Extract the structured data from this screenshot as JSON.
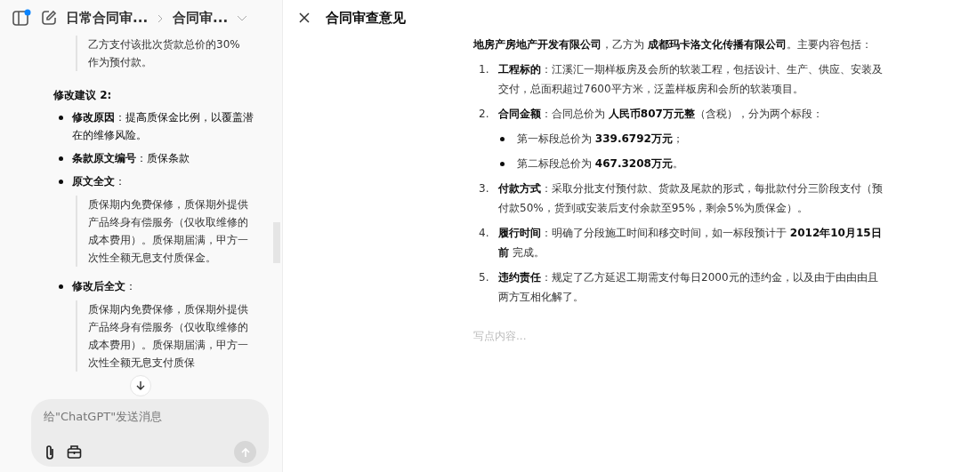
{
  "sidebar": {
    "breadcrumb": [
      "日常合同审...",
      "合同审..."
    ],
    "quote_tail": [
      "乙方支付该批次货款总价的30%",
      "作为预付款。"
    ],
    "suggestion": {
      "title": "修改建议 2:",
      "items": [
        {
          "text": "**修改原因**：提高质保金比例，以覆盖潜在的维修风险。"
        },
        {
          "text": "**条款原文编号**：质保条款"
        },
        {
          "text": "**原文全文**：",
          "quote": "质保期内免费保修，质保期外提供产品终身有偿服务（仅收取维修的成本费用）。质保期届满，甲方一次性全额无息支付质保金。"
        },
        {
          "text": "**修改后全文**：",
          "quote": "质保期内免费保修，质保期外提供产品终身有偿服务（仅收取维修的成本费用）。质保期届满，甲方一次性全额无息支付质保"
        }
      ]
    },
    "composer": {
      "placeholder": "给\"ChatGPT\"发送消息"
    }
  },
  "panel": {
    "title": "合同审查意见",
    "intro": "**地房产房地产开发有限公司**，乙方为 **成都玛卡洛文化传播有限公司**。主要内容包括：",
    "items": [
      {
        "number": "1.",
        "text": "**工程标的**：江溪汇一期样板房及会所的软装工程，包括设计、生产、供应、安装及交付，总面积超过7600平方米，泛盖样板房和会所的软装项目。"
      },
      {
        "number": "2.",
        "text": "**合同金额**：合同总价为 **人民币807万元整**（含税），分为两个标段：",
        "children": [
          {
            "text": "第一标段总价为 **339.6792万元**；"
          },
          {
            "text": "第二标段总价为 **467.3208万元**。"
          }
        ]
      },
      {
        "number": "3.",
        "text": "**付款方式**：采取分批支付预付款、货款及尾款的形式，每批款付分三阶段支付（预付款50%，货到或安装后支付余款至95%，剩余5%为质保金）。"
      },
      {
        "number": "4.",
        "text": "**履行时间**：明确了分段施工时间和移交时间，如一标段预计于 **2012年10月15日前** 完成。"
      },
      {
        "number": "5.",
        "text": "**违约责任**：规定了乙方延迟工期需支付每日2000元的违约金，以及由于由由由且两方互相化解了。"
      }
    ],
    "editor": {
      "placeholder": "写点内容..."
    }
  }
}
